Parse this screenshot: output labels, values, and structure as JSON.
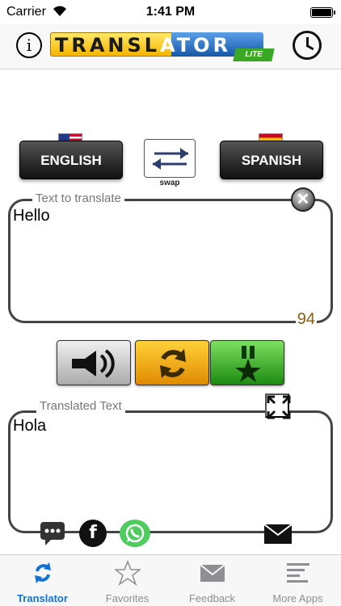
{
  "status_bar": {
    "carrier": "Carrier",
    "time": "1:41 PM"
  },
  "nav": {
    "info_label": "i",
    "logo_text_main": "TRANSL",
    "logo_text_tail": "ATOR",
    "logo_badge": "LITE",
    "icons": {
      "info": "info-icon",
      "history": "clock-icon"
    }
  },
  "languages": {
    "from_label": "ENGLISH",
    "to_label": "SPANISH",
    "swap_label": "swap",
    "from_flag": "us-flag-icon",
    "to_flag": "spain-flag-icon"
  },
  "source": {
    "legend": "Text to translate",
    "text": "Hello",
    "char_count": "94",
    "clear_label": "✕"
  },
  "target": {
    "legend": "Translated Text",
    "text": "Hola"
  },
  "actions": {
    "speak_icon": "speaker-icon",
    "translate_icon": "refresh-arrows-icon",
    "favorite_icon": "medal-star-icon"
  },
  "share": {
    "fb_label": "f",
    "icons": [
      "message-icon",
      "facebook-icon",
      "whatsapp-icon",
      "mail-icon"
    ]
  },
  "tabs": [
    {
      "label": "Translator",
      "icon": "translate-arrows-icon",
      "active": true
    },
    {
      "label": "Favorites",
      "icon": "star-icon",
      "active": false
    },
    {
      "label": "Feedback",
      "icon": "envelope-icon",
      "active": false
    },
    {
      "label": "More Apps",
      "icon": "list-icon",
      "active": false
    }
  ],
  "colors": {
    "accent": "#1273d4",
    "count": "#8a5a10",
    "tab_inactive": "#8e8e93"
  }
}
